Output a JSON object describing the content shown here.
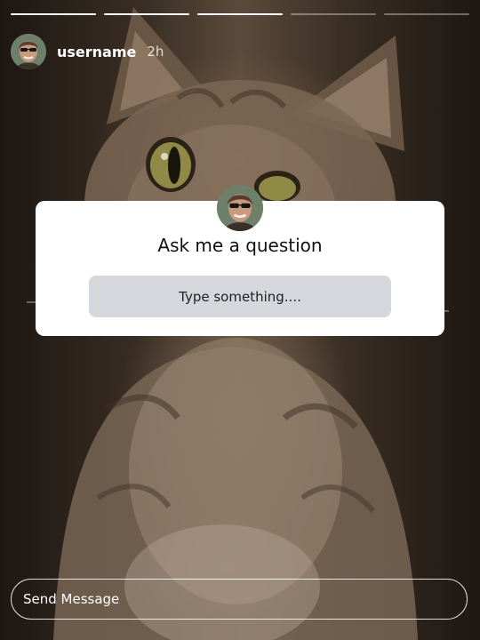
{
  "progress": {
    "segments": [
      {
        "fill": 1.0
      },
      {
        "fill": 1.0
      },
      {
        "fill": 1.0
      },
      {
        "fill": 0.0
      },
      {
        "fill": 0.0
      }
    ]
  },
  "header": {
    "username": "username",
    "timestamp": "2h",
    "avatar_icon": "profile-photo"
  },
  "question_sticker": {
    "title": "Ask me a question",
    "placeholder": "Type something....",
    "avatar_icon": "profile-photo"
  },
  "footer": {
    "send_message_placeholder": "Send Message"
  },
  "colors": {
    "card_background": "#ffffff",
    "answer_field_background": "#d5d7dc",
    "progress_active": "#ffffff"
  }
}
